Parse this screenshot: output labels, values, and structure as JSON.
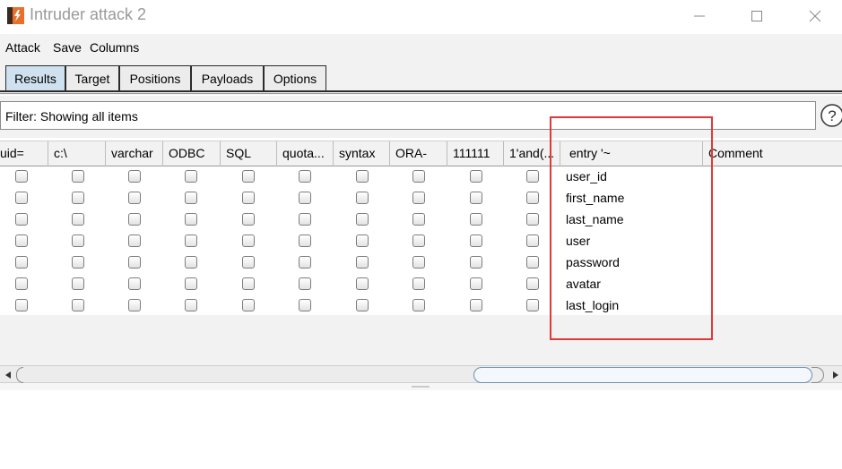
{
  "window": {
    "title": "Intruder attack 2",
    "icon": "burp-app-icon",
    "controls": [
      "minimize-icon",
      "maximize-icon",
      "close-icon"
    ]
  },
  "menu": {
    "attack": "Attack",
    "save": "Save",
    "columns": "Columns"
  },
  "tabs": [
    {
      "label": "Results",
      "active": true
    },
    {
      "label": "Target",
      "active": false
    },
    {
      "label": "Positions",
      "active": false
    },
    {
      "label": "Payloads",
      "active": false
    },
    {
      "label": "Options",
      "active": false
    }
  ],
  "filter": {
    "text": "Filter: Showing all items",
    "help_icon": "help-icon"
  },
  "table": {
    "columns": [
      "uid=",
      "c:\\",
      "varchar",
      "ODBC",
      "SQL",
      "quota...",
      "syntax",
      "ORA-",
      "111111",
      "1'and(...",
      "entry '~",
      "Comment"
    ],
    "rows": [
      {
        "entry": "user_id"
      },
      {
        "entry": "first_name"
      },
      {
        "entry": "last_name"
      },
      {
        "entry": "user"
      },
      {
        "entry": "password"
      },
      {
        "entry": "avatar"
      },
      {
        "entry": "last_login"
      }
    ]
  },
  "colors": {
    "highlight": "#e0393b",
    "active_tab": "#cfe0ef",
    "panel_bg": "#f2f2f2"
  }
}
